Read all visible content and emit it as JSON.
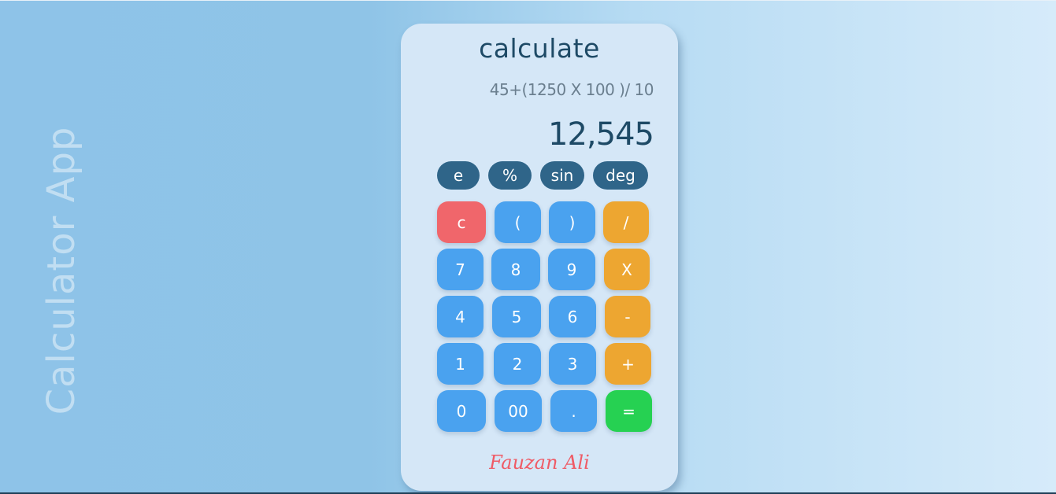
{
  "app": {
    "side_title": "Calculator App"
  },
  "calculator": {
    "title": "calculate",
    "expression": "45+(1250 X 100 )/ 10",
    "result": "12,545",
    "function_keys": [
      "e",
      "%",
      "sin",
      "deg"
    ],
    "keys": {
      "clear": "c",
      "open_paren": "(",
      "close_paren": ")",
      "divide": "/",
      "seven": "7",
      "eight": "8",
      "nine": "9",
      "multiply": "X",
      "four": "4",
      "five": "5",
      "six": "6",
      "minus": "-",
      "one": "1",
      "two": "2",
      "three": "3",
      "plus": "+",
      "zero": "0",
      "double_zero": "00",
      "decimal": ".",
      "equals": "="
    },
    "signature": "Fauzan Ali"
  },
  "colors": {
    "card_bg": "#d5e7f7",
    "function_key": "#2f6589",
    "number_key": "#4aa2ef",
    "operator_key": "#eda631",
    "clear_key": "#f0666b",
    "equals_key": "#26d152",
    "signature": "#ef5b66"
  }
}
